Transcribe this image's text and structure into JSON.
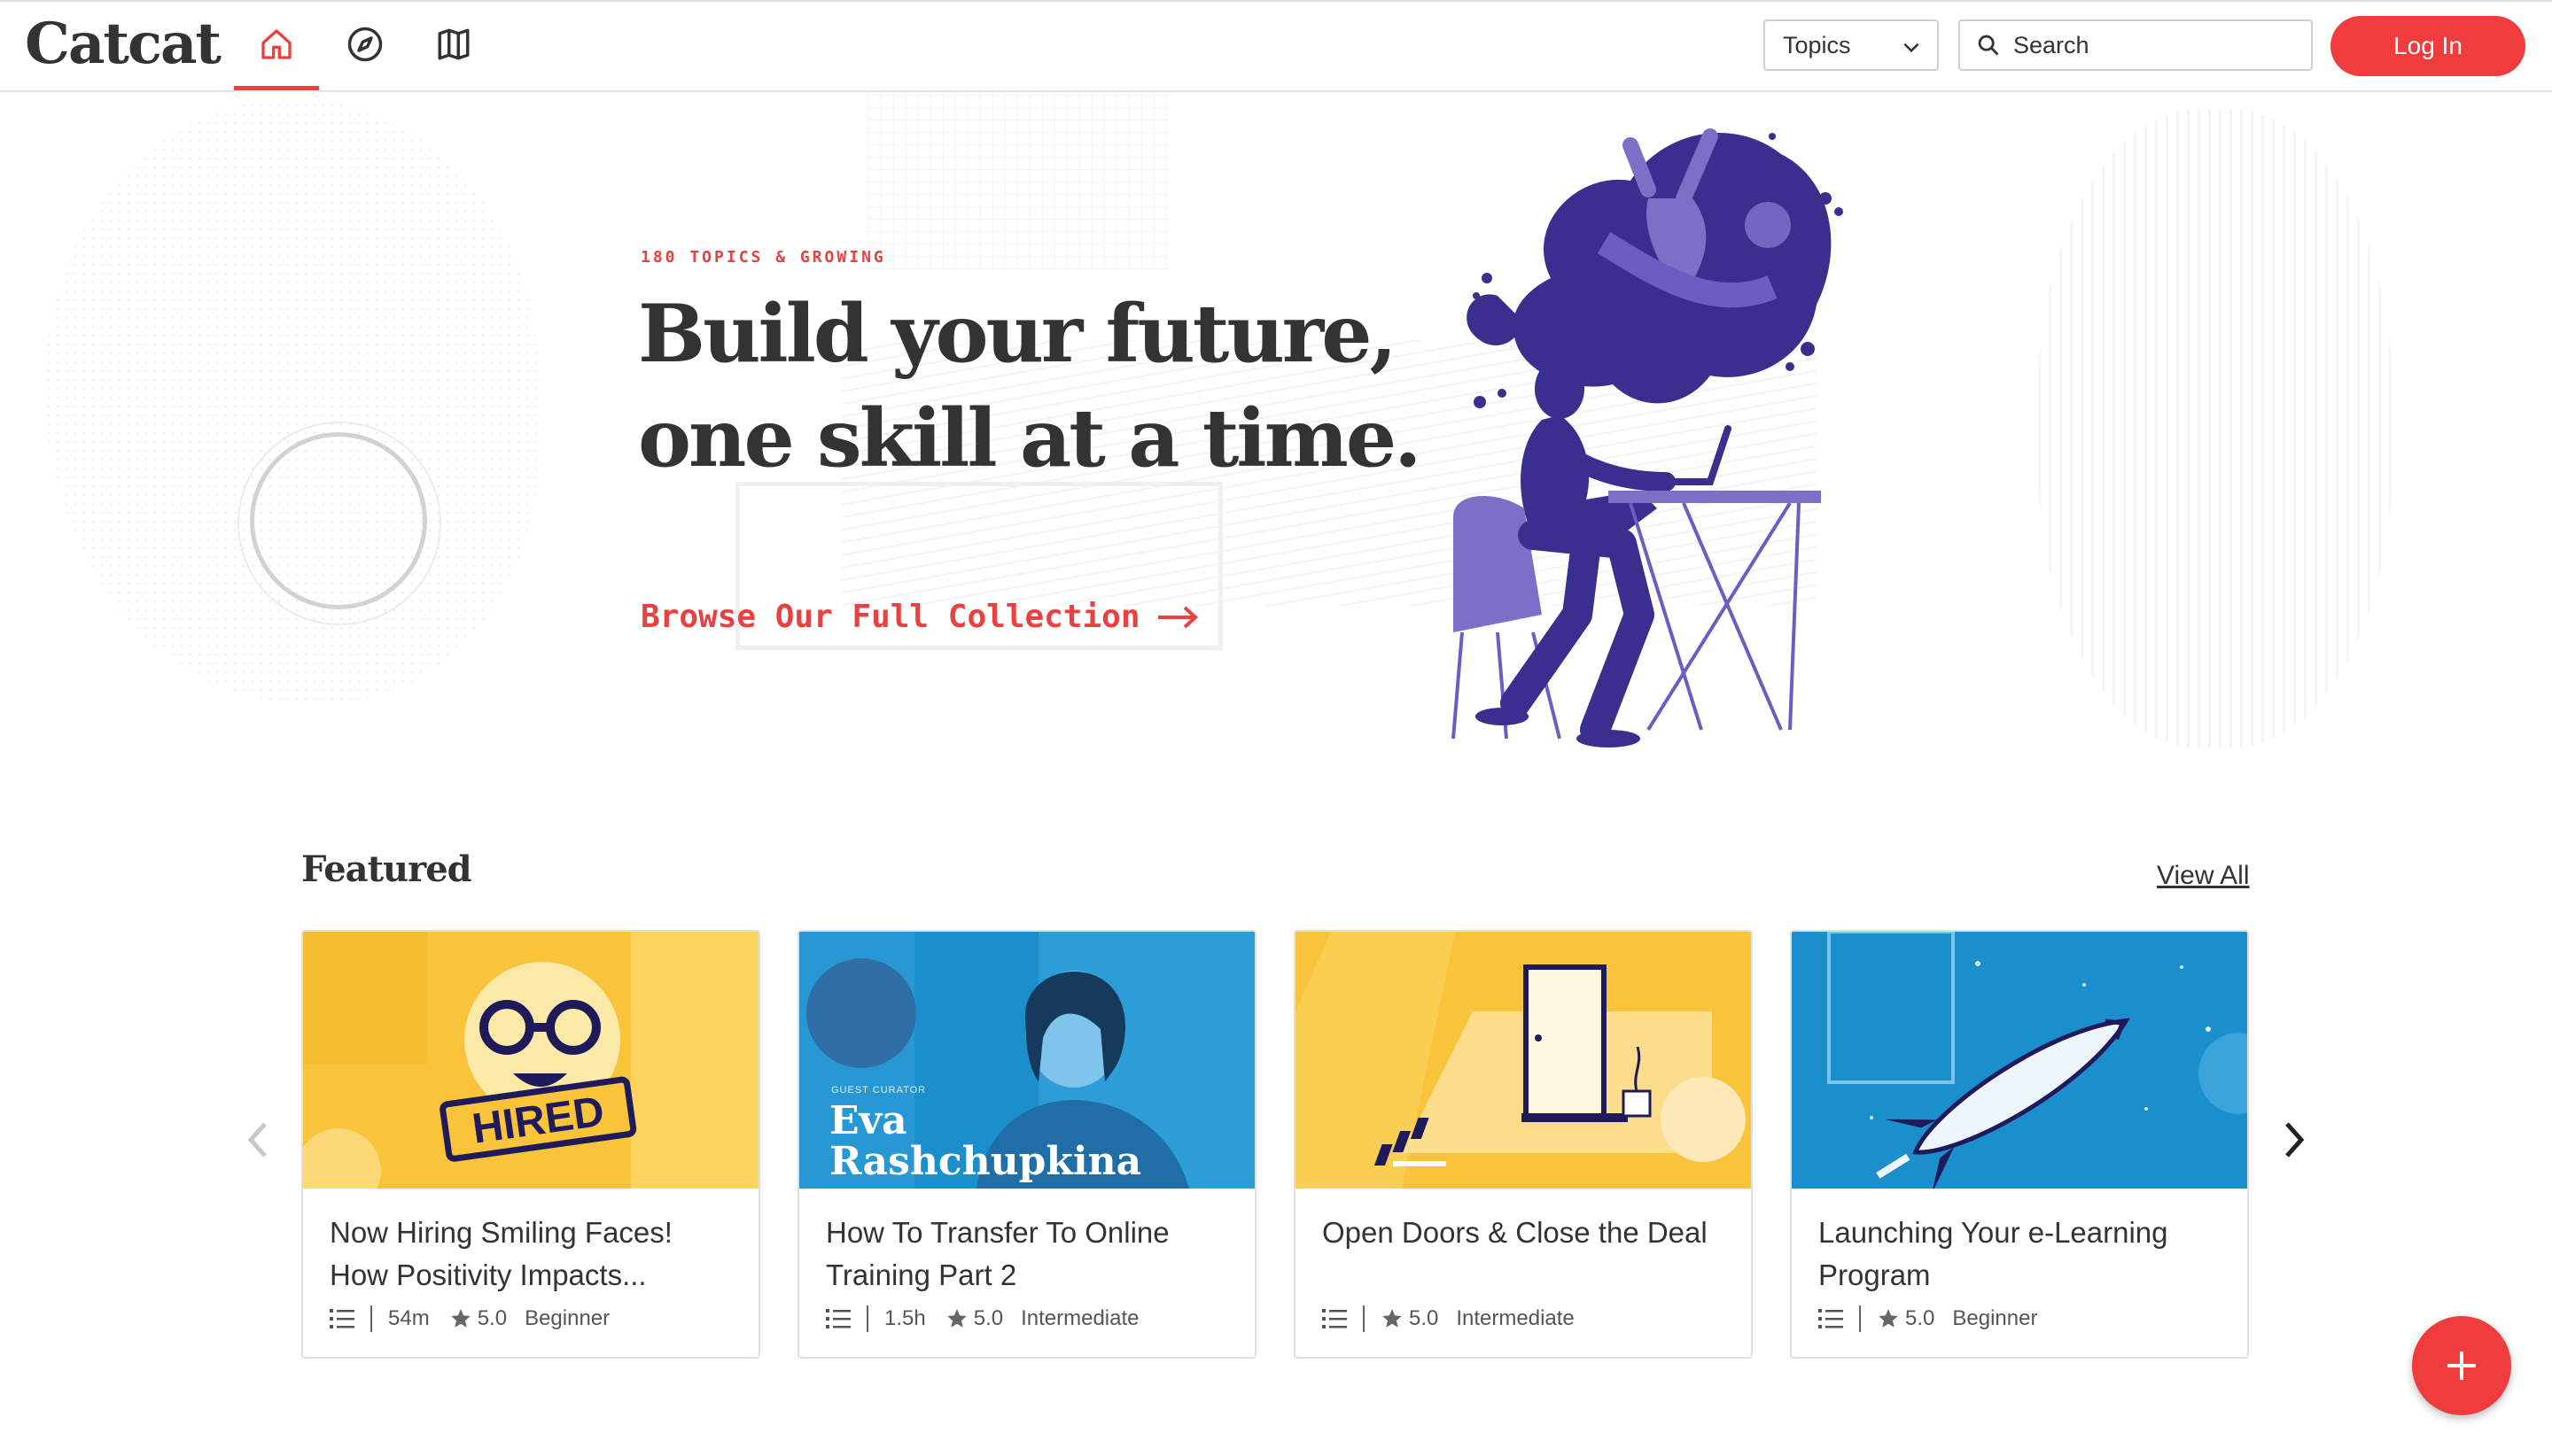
{
  "brand": {
    "name": "Catcat",
    "accent": "#f03c3c",
    "text": "#333333"
  },
  "nav": {
    "icons": [
      "home-icon",
      "compass-icon",
      "map-icon"
    ],
    "active": "home-icon"
  },
  "header": {
    "topics_label": "Topics",
    "search_placeholder": "Search",
    "login_label": "Log In"
  },
  "hero": {
    "eyebrow": "180 TOPICS & GROWING",
    "headline_line1": "Build your future,",
    "headline_line2": "one skill at a time.",
    "cta": "Browse Our Full Collection"
  },
  "featured": {
    "title": "Featured",
    "view_all": "View All",
    "cards": [
      {
        "title": "Now Hiring Smiling Faces! How Positivity Impacts...",
        "duration": "54m",
        "rating": "5.0",
        "level": "Beginner",
        "thumb_text": "HIRED"
      },
      {
        "title": "How To Transfer To Online Training Part 2",
        "duration": "1.5h",
        "rating": "5.0",
        "level": "Intermediate",
        "thumb_eyebrow": "GUEST CURATOR",
        "thumb_name_1": "Eva",
        "thumb_name_2": "Rashchupkina"
      },
      {
        "title": "Open Doors & Close the Deal",
        "duration": "",
        "rating": "5.0",
        "level": "Intermediate"
      },
      {
        "title": "Launching Your e-Learning Program",
        "duration": "",
        "rating": "5.0",
        "level": "Beginner"
      }
    ]
  },
  "fab": {
    "icon": "plus-icon"
  }
}
